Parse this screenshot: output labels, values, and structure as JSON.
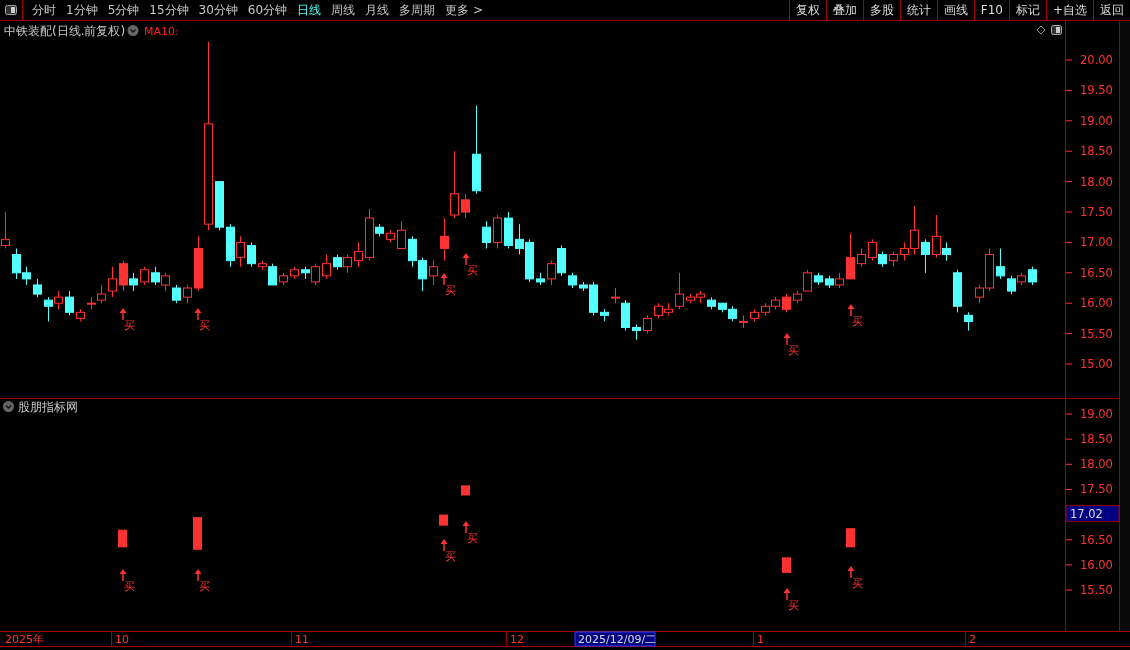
{
  "toolbar": {
    "periods": [
      {
        "label": "分时",
        "selected": false
      },
      {
        "label": "1分钟",
        "selected": false
      },
      {
        "label": "5分钟",
        "selected": false
      },
      {
        "label": "15分钟",
        "selected": false
      },
      {
        "label": "30分钟",
        "selected": false
      },
      {
        "label": "60分钟",
        "selected": false
      },
      {
        "label": "日线",
        "selected": true
      },
      {
        "label": "周线",
        "selected": false
      },
      {
        "label": "月线",
        "selected": false
      },
      {
        "label": "多周期",
        "selected": false
      },
      {
        "label": "更多 >",
        "selected": false
      }
    ],
    "actions": [
      "复权",
      "叠加",
      "多股",
      "统计",
      "画线",
      "F10",
      "标记",
      "+自选",
      "返回"
    ]
  },
  "main_chart": {
    "title": "中铁装配(日线.前复权)",
    "indicator": "MA10:",
    "yticks": [
      "20.00",
      "19.50",
      "19.00",
      "18.50",
      "18.00",
      "17.50",
      "17.00",
      "16.50",
      "16.00",
      "15.50",
      "15.00"
    ],
    "signals": [
      {
        "label": "买"
      },
      {
        "label": "买"
      },
      {
        "label": "买"
      },
      {
        "label": "买"
      },
      {
        "label": "买"
      },
      {
        "label": "买"
      }
    ]
  },
  "indicator_panel": {
    "title": "股朋指标网",
    "yticks": [
      "19.00",
      "18.50",
      "18.00",
      "17.50",
      "16.50",
      "16.00",
      "15.50"
    ],
    "price_label": "17.02",
    "signals": [
      {
        "label": "买"
      },
      {
        "label": "买"
      },
      {
        "label": "买"
      },
      {
        "label": "买"
      },
      {
        "label": "买"
      },
      {
        "label": "买"
      }
    ]
  },
  "time_axis": {
    "labels": [
      {
        "text": "2025年",
        "selected": false
      },
      {
        "text": "10",
        "selected": false
      },
      {
        "text": "11",
        "selected": false
      },
      {
        "text": "12",
        "selected": false
      },
      {
        "text": "2025/12/09/二",
        "selected": true
      },
      {
        "text": "1",
        "selected": false
      },
      {
        "text": "2",
        "selected": false
      }
    ]
  }
}
